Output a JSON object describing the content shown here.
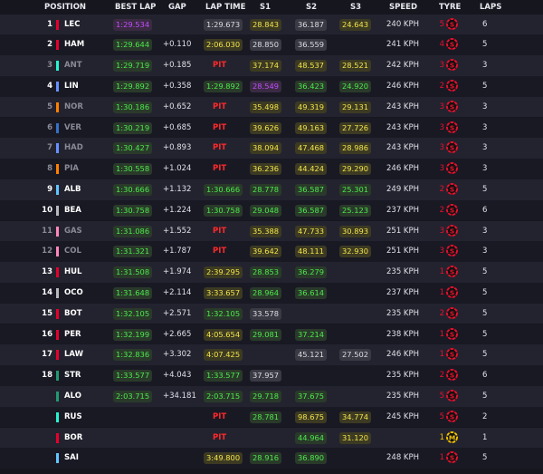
{
  "headers": {
    "position": "POSITION",
    "best_lap": "BEST LAP",
    "gap": "GAP",
    "lap_time": "LAP TIME",
    "s1": "S1",
    "s2": "S2",
    "s3": "S3",
    "speed": "SPEED",
    "tyre": "TYRE",
    "laps": "LAPS"
  },
  "colors": {
    "purple": "#c24cff",
    "green": "#4ce84c",
    "yellow": "#f2e34a",
    "grey": "#dcdce4",
    "pit": "#ff2a2a",
    "soft": "#e8112d",
    "medium": "#f2c200"
  },
  "rows": [
    {
      "pos": "1",
      "dim": false,
      "code": "LEC",
      "team": "#e8002d",
      "best": "1:29.534",
      "best_c": "purple",
      "gap": "",
      "lap": "1:29.673",
      "lap_c": "grey",
      "s1": "28.843",
      "s1_c": "yellow",
      "s2": "36.187",
      "s2_c": "grey",
      "s3": "24.643",
      "s3_c": "yellow",
      "speed": "240 KPH",
      "stint": "5",
      "tyre": "soft",
      "laps": "6"
    },
    {
      "pos": "2",
      "dim": false,
      "code": "HAM",
      "team": "#e8002d",
      "best": "1:29.644",
      "best_c": "green",
      "gap": "+0.110",
      "lap": "2:06.030",
      "lap_c": "yellow",
      "s1": "28.850",
      "s1_c": "grey",
      "s2": "36.559",
      "s2_c": "grey",
      "s3": "",
      "s3_c": "",
      "speed": "241 KPH",
      "stint": "4",
      "tyre": "soft",
      "laps": "5"
    },
    {
      "pos": "3",
      "dim": true,
      "code": "ANT",
      "team": "#27f4d2",
      "best": "1:29.719",
      "best_c": "green",
      "gap": "+0.185",
      "lap": "PIT",
      "lap_c": "pit",
      "s1": "37.174",
      "s1_c": "yellow",
      "s2": "48.537",
      "s2_c": "yellow",
      "s3": "28.521",
      "s3_c": "yellow",
      "speed": "242 KPH",
      "stint": "3",
      "tyre": "soft",
      "laps": "3"
    },
    {
      "pos": "4",
      "dim": false,
      "code": "LIN",
      "team": "#6692ff",
      "best": "1:29.892",
      "best_c": "green",
      "gap": "+0.358",
      "lap": "1:29.892",
      "lap_c": "green",
      "s1": "28.549",
      "s1_c": "purple",
      "s2": "36.423",
      "s2_c": "green",
      "s3": "24.920",
      "s3_c": "green",
      "speed": "246 KPH",
      "stint": "2",
      "tyre": "soft",
      "laps": "5"
    },
    {
      "pos": "5",
      "dim": true,
      "code": "NOR",
      "team": "#ff8000",
      "best": "1:30.186",
      "best_c": "green",
      "gap": "+0.652",
      "lap": "PIT",
      "lap_c": "pit",
      "s1": "35.498",
      "s1_c": "yellow",
      "s2": "49.319",
      "s2_c": "yellow",
      "s3": "29.131",
      "s3_c": "yellow",
      "speed": "243 KPH",
      "stint": "3",
      "tyre": "soft",
      "laps": "3"
    },
    {
      "pos": "6",
      "dim": true,
      "code": "VER",
      "team": "#3671c6",
      "best": "1:30.219",
      "best_c": "green",
      "gap": "+0.685",
      "lap": "PIT",
      "lap_c": "pit",
      "s1": "39.626",
      "s1_c": "yellow",
      "s2": "49.163",
      "s2_c": "yellow",
      "s3": "27.726",
      "s3_c": "yellow",
      "speed": "243 KPH",
      "stint": "3",
      "tyre": "soft",
      "laps": "3"
    },
    {
      "pos": "7",
      "dim": true,
      "code": "HAD",
      "team": "#6692ff",
      "best": "1:30.427",
      "best_c": "green",
      "gap": "+0.893",
      "lap": "PIT",
      "lap_c": "pit",
      "s1": "38.094",
      "s1_c": "yellow",
      "s2": "47.468",
      "s2_c": "yellow",
      "s3": "28.986",
      "s3_c": "yellow",
      "speed": "243 KPH",
      "stint": "3",
      "tyre": "soft",
      "laps": "3"
    },
    {
      "pos": "8",
      "dim": true,
      "code": "PIA",
      "team": "#ff8000",
      "best": "1:30.558",
      "best_c": "green",
      "gap": "+1.024",
      "lap": "PIT",
      "lap_c": "pit",
      "s1": "36.236",
      "s1_c": "yellow",
      "s2": "44.424",
      "s2_c": "yellow",
      "s3": "29.290",
      "s3_c": "yellow",
      "speed": "246 KPH",
      "stint": "3",
      "tyre": "soft",
      "laps": "3"
    },
    {
      "pos": "9",
      "dim": false,
      "code": "ALB",
      "team": "#64c4ff",
      "best": "1:30.666",
      "best_c": "green",
      "gap": "+1.132",
      "lap": "1:30.666",
      "lap_c": "green",
      "s1": "28.778",
      "s1_c": "green",
      "s2": "36.587",
      "s2_c": "green",
      "s3": "25.301",
      "s3_c": "green",
      "speed": "249 KPH",
      "stint": "2",
      "tyre": "soft",
      "laps": "5"
    },
    {
      "pos": "10",
      "dim": false,
      "code": "BEA",
      "team": "#b6babd",
      "best": "1:30.758",
      "best_c": "green",
      "gap": "+1.224",
      "lap": "1:30.758",
      "lap_c": "green",
      "s1": "29.048",
      "s1_c": "green",
      "s2": "36.587",
      "s2_c": "green",
      "s3": "25.123",
      "s3_c": "green",
      "speed": "237 KPH",
      "stint": "2",
      "tyre": "soft",
      "laps": "6"
    },
    {
      "pos": "11",
      "dim": true,
      "code": "GAS",
      "team": "#ff87bc",
      "best": "1:31.086",
      "best_c": "green",
      "gap": "+1.552",
      "lap": "PIT",
      "lap_c": "pit",
      "s1": "35.388",
      "s1_c": "yellow",
      "s2": "47.733",
      "s2_c": "yellow",
      "s3": "30.893",
      "s3_c": "yellow",
      "speed": "251 KPH",
      "stint": "3",
      "tyre": "soft",
      "laps": "3"
    },
    {
      "pos": "12",
      "dim": true,
      "code": "COL",
      "team": "#ff87bc",
      "best": "1:31.321",
      "best_c": "green",
      "gap": "+1.787",
      "lap": "PIT",
      "lap_c": "pit",
      "s1": "39.642",
      "s1_c": "yellow",
      "s2": "48.111",
      "s2_c": "yellow",
      "s3": "32.930",
      "s3_c": "yellow",
      "speed": "251 KPH",
      "stint": "3",
      "tyre": "soft",
      "laps": "3"
    },
    {
      "pos": "13",
      "dim": false,
      "code": "HUL",
      "team": "#e8002d",
      "best": "1:31.508",
      "best_c": "green",
      "gap": "+1.974",
      "lap": "2:39.295",
      "lap_c": "yellow",
      "s1": "28.853",
      "s1_c": "green",
      "s2": "36.279",
      "s2_c": "green",
      "s3": "",
      "s3_c": "",
      "speed": "235 KPH",
      "stint": "1",
      "tyre": "soft",
      "laps": "5"
    },
    {
      "pos": "14",
      "dim": false,
      "code": "OCO",
      "team": "#b6babd",
      "best": "1:31.648",
      "best_c": "green",
      "gap": "+2.114",
      "lap": "3:33.657",
      "lap_c": "yellow",
      "s1": "28.964",
      "s1_c": "green",
      "s2": "36.614",
      "s2_c": "green",
      "s3": "",
      "s3_c": "",
      "speed": "237 KPH",
      "stint": "1",
      "tyre": "soft",
      "laps": "5"
    },
    {
      "pos": "15",
      "dim": false,
      "code": "BOT",
      "team": "#e8002d",
      "best": "1:32.105",
      "best_c": "green",
      "gap": "+2.571",
      "lap": "1:32.105",
      "lap_c": "green",
      "s1": "33.578",
      "s1_c": "grey",
      "s2": "",
      "s2_c": "",
      "s3": "",
      "s3_c": "",
      "speed": "235 KPH",
      "stint": "2",
      "tyre": "soft",
      "laps": "5"
    },
    {
      "pos": "16",
      "dim": false,
      "code": "PER",
      "team": "#e8002d",
      "best": "1:32.199",
      "best_c": "green",
      "gap": "+2.665",
      "lap": "4:05.654",
      "lap_c": "yellow",
      "s1": "29.081",
      "s1_c": "green",
      "s2": "37.214",
      "s2_c": "green",
      "s3": "",
      "s3_c": "",
      "speed": "238 KPH",
      "stint": "1",
      "tyre": "soft",
      "laps": "5"
    },
    {
      "pos": "17",
      "dim": false,
      "code": "LAW",
      "team": "#e8002d",
      "best": "1:32.836",
      "best_c": "green",
      "gap": "+3.302",
      "lap": "4:07.425",
      "lap_c": "yellow",
      "s1": "",
      "s1_c": "",
      "s2": "45.121",
      "s2_c": "grey",
      "s3": "27.502",
      "s3_c": "grey",
      "speed": "246 KPH",
      "stint": "1",
      "tyre": "soft",
      "laps": "5"
    },
    {
      "pos": "18",
      "dim": false,
      "code": "STR",
      "team": "#229971",
      "best": "1:33.577",
      "best_c": "green",
      "gap": "+4.043",
      "lap": "1:33.577",
      "lap_c": "green",
      "s1": "37.957",
      "s1_c": "grey",
      "s2": "",
      "s2_c": "",
      "s3": "",
      "s3_c": "",
      "speed": "235 KPH",
      "stint": "2",
      "tyre": "soft",
      "laps": "6"
    },
    {
      "pos": "",
      "dim": false,
      "code": "ALO",
      "team": "#229971",
      "best": "2:03.715",
      "best_c": "green",
      "gap": "+34.181",
      "lap": "2:03.715",
      "lap_c": "green",
      "s1": "29.718",
      "s1_c": "green",
      "s2": "37.675",
      "s2_c": "green",
      "s3": "",
      "s3_c": "",
      "speed": "235 KPH",
      "stint": "5",
      "tyre": "soft",
      "laps": "5"
    },
    {
      "pos": "",
      "dim": false,
      "code": "RUS",
      "team": "#27f4d2",
      "best": "",
      "best_c": "",
      "gap": "",
      "lap": "PIT",
      "lap_c": "pit",
      "s1": "28.781",
      "s1_c": "green",
      "s2": "98.675",
      "s2_c": "yellow",
      "s3": "34.774",
      "s3_c": "yellow",
      "speed": "245 KPH",
      "stint": "5",
      "tyre": "soft",
      "laps": "2"
    },
    {
      "pos": "",
      "dim": false,
      "code": "BOR",
      "team": "#e8002d",
      "best": "",
      "best_c": "",
      "gap": "",
      "lap": "PIT",
      "lap_c": "pit",
      "s1": "",
      "s1_c": "",
      "s2": "44.964",
      "s2_c": "green",
      "s3": "31.120",
      "s3_c": "yellow",
      "speed": "",
      "stint": "1",
      "tyre": "medium",
      "laps": "1"
    },
    {
      "pos": "",
      "dim": false,
      "code": "SAI",
      "team": "#64c4ff",
      "best": "",
      "best_c": "",
      "gap": "",
      "lap": "3:49.800",
      "lap_c": "yellow",
      "s1": "28.916",
      "s1_c": "green",
      "s2": "36.890",
      "s2_c": "green",
      "s3": "",
      "s3_c": "",
      "speed": "248 KPH",
      "stint": "1",
      "tyre": "soft",
      "laps": "5"
    }
  ]
}
